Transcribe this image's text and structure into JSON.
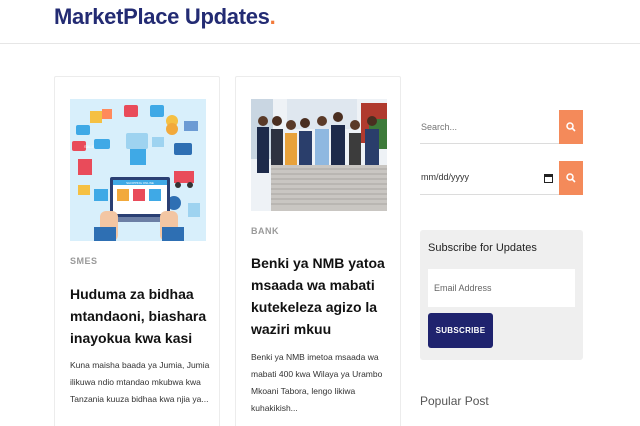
{
  "site": {
    "title": "MarketPlace Updates",
    "title_dot": "."
  },
  "posts": [
    {
      "category": "SMES",
      "title": "Huduma za bidhaa mtandaoni, biashara inayokua kwa kasi",
      "excerpt": "Kuna maisha baada ya Jumia, Jumia ilikuwa ndio mtandao mkubwa kwa Tanzania kuuza bidhaa kwa njia ya...",
      "image_sign": "SHOPPING ONLINE",
      "image_tag": "SALE"
    },
    {
      "category": "BANK",
      "title": "Benki ya NMB yatoa msaada wa mabati kutekeleza agizo la waziri mkuu",
      "excerpt": "Benki ya NMB imetoa msaada wa mabati 400 kwa Wilaya ya Urambo Mkoani Tabora, lengo likiwa kuhakikish..."
    }
  ],
  "sidebar": {
    "search_placeholder": "Search...",
    "date_placeholder": "mm/dd/yyyy",
    "subscribe_title": "Subscribe for Updates",
    "email_placeholder": "Email Address",
    "subscribe_button": "SUBSCRIBE",
    "popular_heading": "Popular Post"
  },
  "colors": {
    "brand": "#232b73",
    "accent": "#f48a5a",
    "button": "#1f236e"
  },
  "icons": [
    "search-icon",
    "calendar-icon"
  ]
}
